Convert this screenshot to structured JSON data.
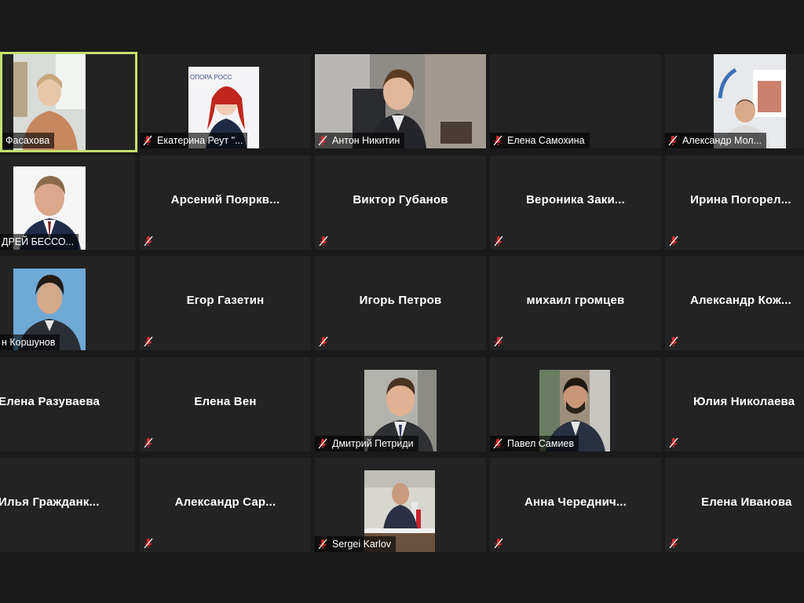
{
  "participants": [
    {
      "name": "Фасахова",
      "video": true
    },
    {
      "name": "Екатерина Реут \"...",
      "video": true
    },
    {
      "name": "Антон Никитин",
      "video": true
    },
    {
      "name": "Елена Самохина",
      "video": false
    },
    {
      "name": "Александр Мол...",
      "video": true
    },
    {
      "name": "ДРЕЙ БЕССО...",
      "video": true
    },
    {
      "name": "Арсений  Пояркв...",
      "video": false
    },
    {
      "name": "Виктор Губанов",
      "video": false
    },
    {
      "name": "Вероника  Заки...",
      "video": false
    },
    {
      "name": "Ирина  Погорел...",
      "video": false
    },
    {
      "name": "н Коршунов",
      "video": true
    },
    {
      "name": "Егор Газетин",
      "video": false
    },
    {
      "name": "Игорь Петров",
      "video": false
    },
    {
      "name": "михаил громцев",
      "video": false
    },
    {
      "name": "Александр  Кож...",
      "video": false
    },
    {
      "name": "Елена Разуваева",
      "video": false
    },
    {
      "name": "Елена Вен",
      "video": false
    },
    {
      "name": "Дмитрий Петриди",
      "video": true
    },
    {
      "name": "Павел Самиев",
      "video": true
    },
    {
      "name": "Юлия Николаева",
      "video": false
    },
    {
      "name": "Илья  Гражданк...",
      "video": false
    },
    {
      "name": "Александр  Сар...",
      "video": false
    },
    {
      "name": "Sergei Karlov",
      "video": true
    },
    {
      "name": "Анна  Череднич...",
      "video": false
    },
    {
      "name": "Елена Иванова",
      "video": false
    }
  ],
  "photo_text": {
    "banner": "ОПОРА РОСС"
  },
  "colors": {
    "active_speaker_border": "#c6e06e",
    "mute": "#e02b2b",
    "tile_bg": "#232323"
  },
  "icons": {
    "mute": "microphone-muted-icon"
  }
}
